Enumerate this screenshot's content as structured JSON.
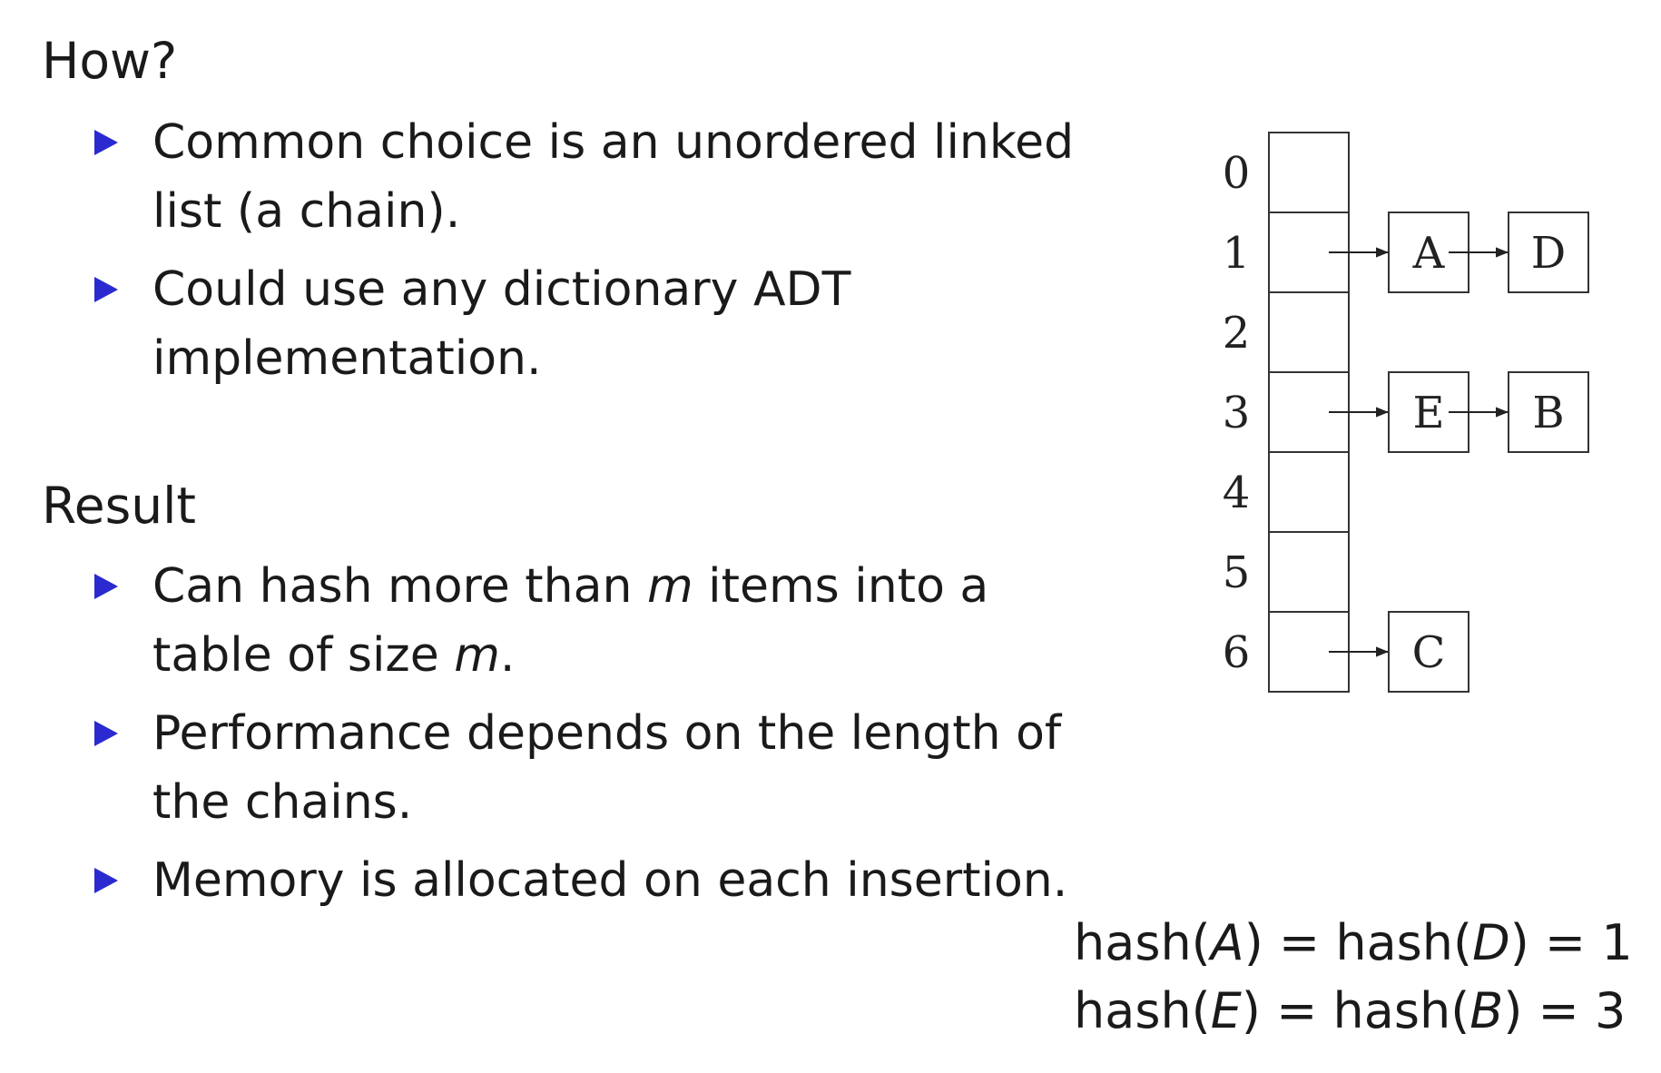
{
  "how": {
    "heading": "How?",
    "bullets": [
      "Common choice is an unordered linked list (a chain).",
      "Could use any dictionary ADT implementation."
    ]
  },
  "result": {
    "heading": "Result",
    "bullets": [
      {
        "pre": "Can hash more than ",
        "var1": "m",
        "mid": " items into a table of size ",
        "var2": "m",
        "post": "."
      },
      "Performance depends on the length of the chains.",
      "Memory is allocated on each insertion."
    ]
  },
  "diagram": {
    "slots": [
      "0",
      "1",
      "2",
      "3",
      "4",
      "5",
      "6"
    ],
    "chains": [
      {
        "slot": 1,
        "nodes": [
          "A",
          "D"
        ]
      },
      {
        "slot": 3,
        "nodes": [
          "E",
          "B"
        ]
      },
      {
        "slot": 6,
        "nodes": [
          "C"
        ]
      }
    ]
  },
  "equations": [
    {
      "f1": "hash(",
      "v1": "A",
      "c1": ") = hash(",
      "v2": "D",
      "c2": ") = ",
      "val": "1"
    },
    {
      "f1": "hash(",
      "v1": "E",
      "c1": ") = hash(",
      "v2": "B",
      "c2": ") = ",
      "val": "3"
    }
  ]
}
